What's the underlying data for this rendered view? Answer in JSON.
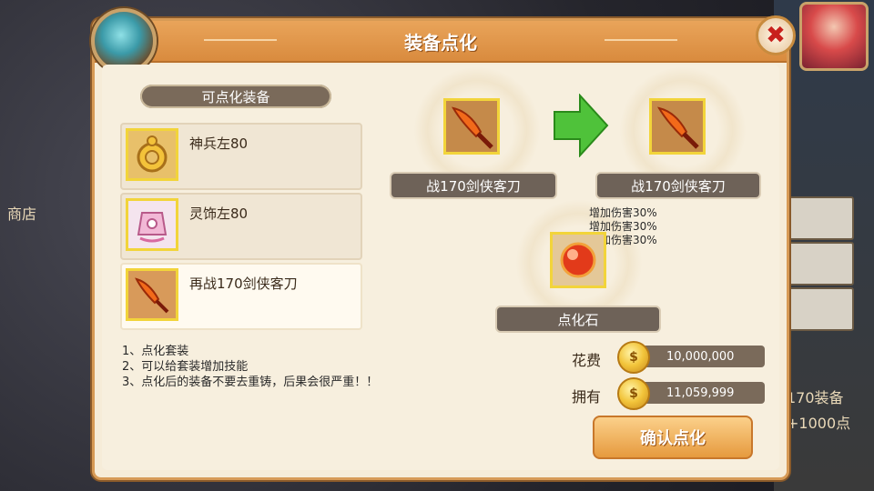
{
  "dialog": {
    "title": "装备点化",
    "close_icon": "✖"
  },
  "list": {
    "header": "可点化装备",
    "items": [
      {
        "label": "神兵左80",
        "icon": "gold-ring-icon"
      },
      {
        "label": "灵饰左80",
        "icon": "pink-ornament-icon"
      },
      {
        "label": "再战170剑侠客刀",
        "icon": "flame-blade-icon"
      }
    ]
  },
  "source": {
    "name": "战170剑侠客刀",
    "icon": "flame-blade-icon"
  },
  "target": {
    "name": "战170剑侠客刀",
    "icon": "flame-blade-icon"
  },
  "stats": [
    "增加伤害30%",
    "增加伤害30%",
    "增加伤害30%"
  ],
  "stone": {
    "name": "点化石",
    "icon": "red-orb-icon"
  },
  "notes": [
    "1、点化套装",
    "2、可以给套装增加技能",
    "3、点化后的装备不要去重铸，后果会很严重！！"
  ],
  "cost": {
    "label": "花费",
    "value": "10,000,000"
  },
  "owned": {
    "label": "拥有",
    "value": "11,059,999"
  },
  "confirm_label": "确认点化",
  "background": {
    "shop_text": "商店",
    "right_text_1": "170装备",
    "right_text_2": "+1000点"
  },
  "colors": {
    "accent": "#e69a3e",
    "slot_border": "#f2d43a",
    "plate": "#6e6258"
  }
}
